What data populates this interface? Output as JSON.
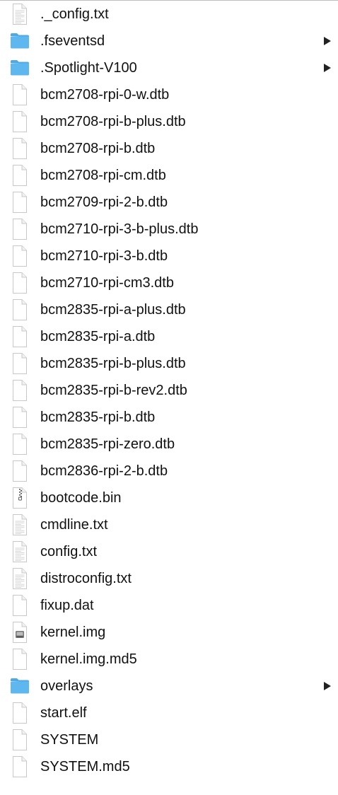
{
  "colors": {
    "folder": "#5eb8ef",
    "folder_tab": "#4fa9e3",
    "doc_border": "#c8c8c8",
    "text": "#111111",
    "disclosure": "#222222"
  },
  "items": [
    {
      "name": "._config.txt",
      "icon": "text-document-icon",
      "expandable": false
    },
    {
      "name": ".fseventsd",
      "icon": "folder-icon",
      "expandable": true
    },
    {
      "name": ".Spotlight-V100",
      "icon": "folder-icon",
      "expandable": true
    },
    {
      "name": "bcm2708-rpi-0-w.dtb",
      "icon": "blank-document-icon",
      "expandable": false
    },
    {
      "name": "bcm2708-rpi-b-plus.dtb",
      "icon": "blank-document-icon",
      "expandable": false
    },
    {
      "name": "bcm2708-rpi-b.dtb",
      "icon": "blank-document-icon",
      "expandable": false
    },
    {
      "name": "bcm2708-rpi-cm.dtb",
      "icon": "blank-document-icon",
      "expandable": false
    },
    {
      "name": "bcm2709-rpi-2-b.dtb",
      "icon": "blank-document-icon",
      "expandable": false
    },
    {
      "name": "bcm2710-rpi-3-b-plus.dtb",
      "icon": "blank-document-icon",
      "expandable": false
    },
    {
      "name": "bcm2710-rpi-3-b.dtb",
      "icon": "blank-document-icon",
      "expandable": false
    },
    {
      "name": "bcm2710-rpi-cm3.dtb",
      "icon": "blank-document-icon",
      "expandable": false
    },
    {
      "name": "bcm2835-rpi-a-plus.dtb",
      "icon": "blank-document-icon",
      "expandable": false
    },
    {
      "name": "bcm2835-rpi-a.dtb",
      "icon": "blank-document-icon",
      "expandable": false
    },
    {
      "name": "bcm2835-rpi-b-plus.dtb",
      "icon": "blank-document-icon",
      "expandable": false
    },
    {
      "name": "bcm2835-rpi-b-rev2.dtb",
      "icon": "blank-document-icon",
      "expandable": false
    },
    {
      "name": "bcm2835-rpi-b.dtb",
      "icon": "blank-document-icon",
      "expandable": false
    },
    {
      "name": "bcm2835-rpi-zero.dtb",
      "icon": "blank-document-icon",
      "expandable": false
    },
    {
      "name": "bcm2836-rpi-2-b.dtb",
      "icon": "blank-document-icon",
      "expandable": false
    },
    {
      "name": "bootcode.bin",
      "icon": "archive-icon",
      "expandable": false
    },
    {
      "name": "cmdline.txt",
      "icon": "text-document-icon",
      "expandable": false
    },
    {
      "name": "config.txt",
      "icon": "text-document-icon",
      "expandable": false
    },
    {
      "name": "distroconfig.txt",
      "icon": "text-document-icon",
      "expandable": false
    },
    {
      "name": "fixup.dat",
      "icon": "blank-document-icon",
      "expandable": false
    },
    {
      "name": "kernel.img",
      "icon": "disk-image-icon",
      "expandable": false
    },
    {
      "name": "kernel.img.md5",
      "icon": "blank-document-icon",
      "expandable": false
    },
    {
      "name": "overlays",
      "icon": "folder-icon",
      "expandable": true
    },
    {
      "name": "start.elf",
      "icon": "blank-document-icon",
      "expandable": false
    },
    {
      "name": "SYSTEM",
      "icon": "blank-document-icon",
      "expandable": false
    },
    {
      "name": "SYSTEM.md5",
      "icon": "blank-document-icon",
      "expandable": false
    }
  ]
}
